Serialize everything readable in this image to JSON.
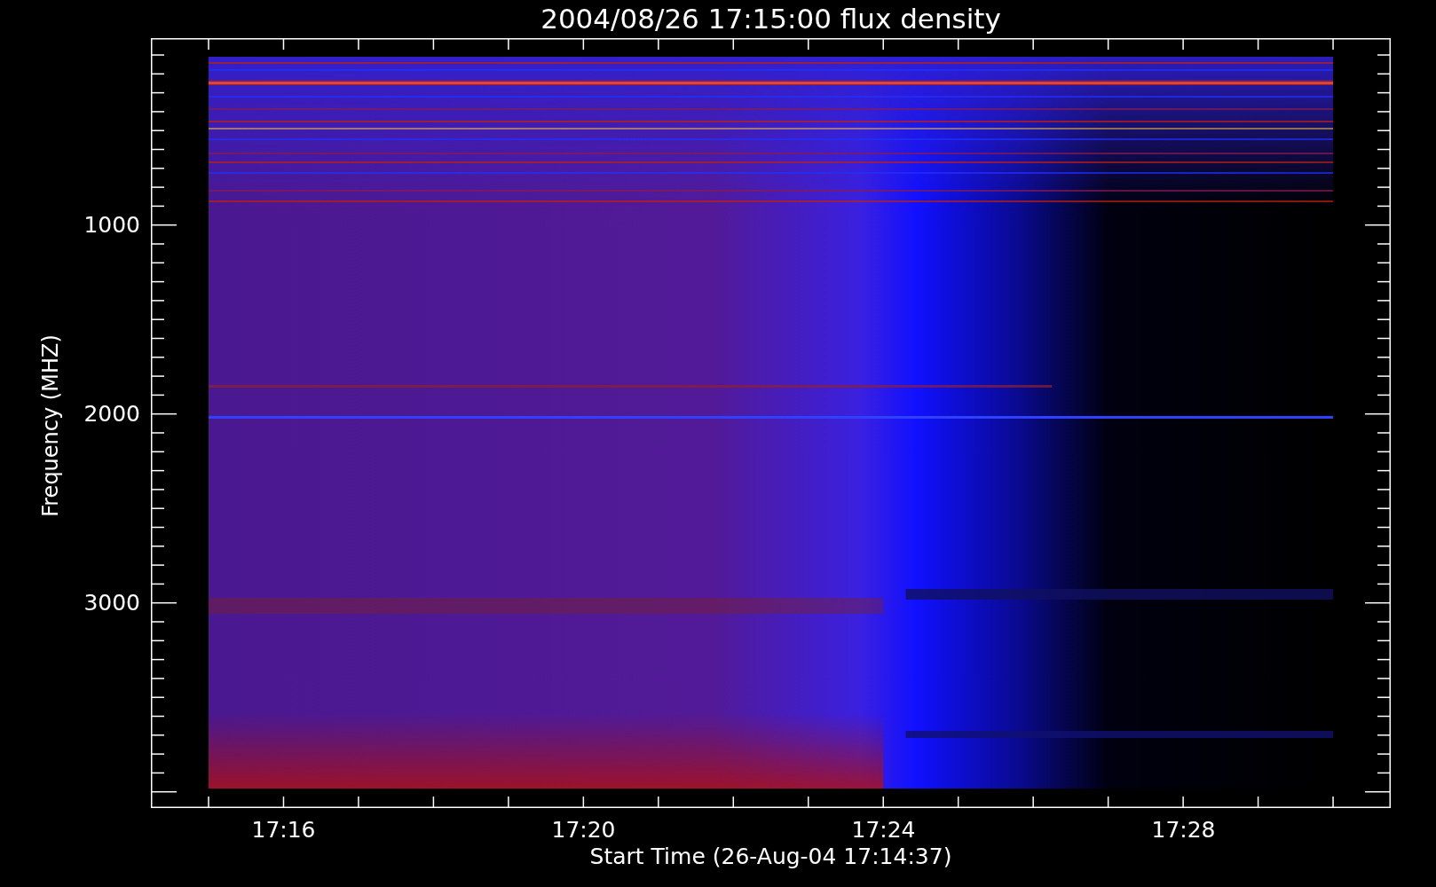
{
  "title": "2004/08/26 17:15:00 flux density",
  "y_axis": {
    "label": "Frequency (MHZ)",
    "ticks": [
      "1000",
      "2000",
      "3000"
    ]
  },
  "x_axis": {
    "label": "Start Time (26-Aug-04 17:14:37)",
    "ticks": [
      "17:16",
      "17:20",
      "17:24",
      "17:28"
    ]
  }
}
